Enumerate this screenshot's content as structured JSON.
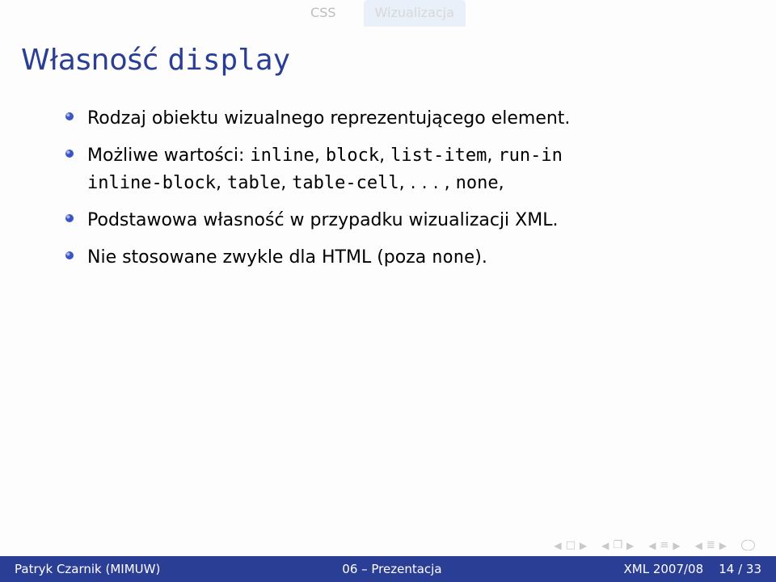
{
  "tabs": {
    "left": "CSS",
    "right": "Wizualizacja"
  },
  "title": {
    "prefix": "Własność ",
    "code": "display"
  },
  "bullets": {
    "b1": "Rodzaj obiektu wizualnego reprezentującego element.",
    "b2": {
      "prefix": "Możliwe wartości: ",
      "code1": "inline",
      "c1": ", ",
      "code2": "block",
      "c2": ", ",
      "code3": "list-item",
      "c3": ", ",
      "code4": "run-in",
      "line2code1": "inline-block",
      "l2c1": ", ",
      "line2code2": "table",
      "l2c2": ", ",
      "line2code3": "table-cell",
      "l2c3": ", . . . , ",
      "line2code4": "none",
      "l2c4": ","
    },
    "b3": "Podstawowa własność w przypadku wizualizacji XML.",
    "b4": {
      "prefix": "Nie stosowane zwykle dla HTML (poza ",
      "code": "none",
      "suffix": ")."
    }
  },
  "footer": {
    "left": "Patryk Czarnik (MIMUW)",
    "center": "06 – Prezentacja",
    "right_label": "XML 2007/08",
    "right_page": "14 / 33"
  }
}
